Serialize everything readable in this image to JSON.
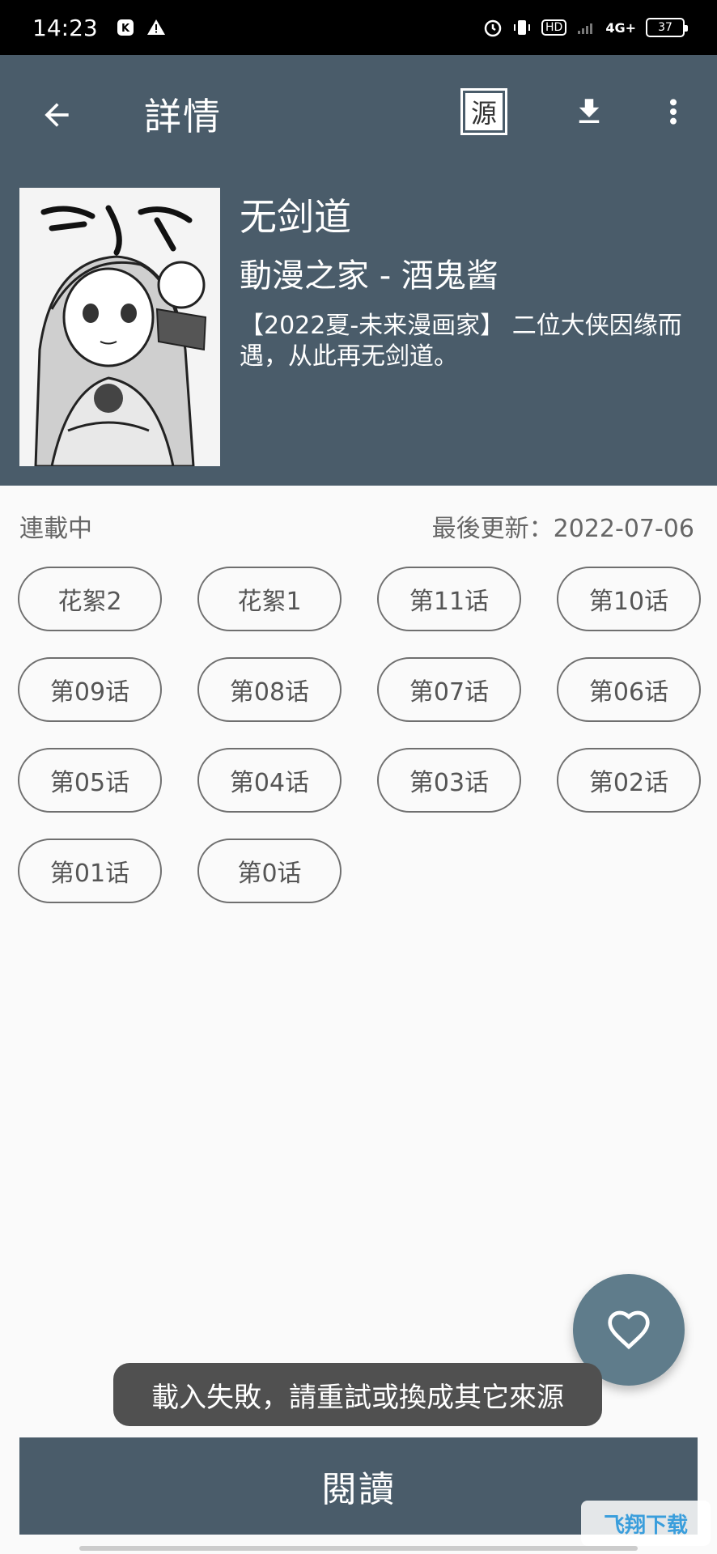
{
  "status_bar": {
    "time": "14:23",
    "network": "4G+",
    "hd": "HD",
    "battery": "37"
  },
  "toolbar": {
    "title": "詳情",
    "source_label": "源"
  },
  "comic": {
    "title": "无剑道",
    "author": "動漫之家 - 酒鬼酱",
    "description": "【2022夏-未来漫画家】 二位大侠因缘而遇，从此再无剑道。",
    "status": "連載中",
    "last_update": "最後更新：2022-07-06"
  },
  "chapters": [
    "花絮2",
    "花絮1",
    "第11话",
    "第10话",
    "第09话",
    "第08话",
    "第07话",
    "第06话",
    "第05话",
    "第04话",
    "第03话",
    "第02话",
    "第01话",
    "第0话"
  ],
  "toast": "載入失敗，請重試或換成其它來源",
  "read_button": "閱讀",
  "watermark": "飞翔下载",
  "colors": {
    "header": "#4a5c6a",
    "fab": "#5f7c8b",
    "background": "#fafafa"
  }
}
